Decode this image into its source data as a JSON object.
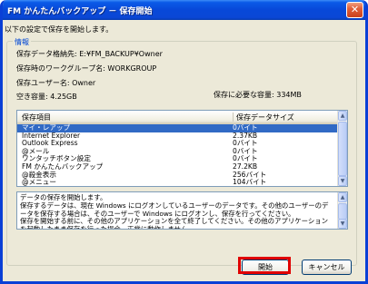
{
  "window": {
    "title": "FM かんたんバックアップ － 保存開始"
  },
  "intro_text": "以下の設定で保存を開始します。",
  "info": {
    "legend": "情報",
    "dest_label": "保存データ格納先: E:¥FM_BACKUP¥Owner",
    "workgroup_label": "保存時のワークグループ名: WORKGROUP",
    "user_label": "保存ユーザー名: Owner",
    "free_space": "空き容量:  4.25GB",
    "required_space": "保存に必要な容量:  334MB"
  },
  "list": {
    "headers": [
      "保存項目",
      "保存データサイズ"
    ],
    "rows": [
      {
        "name": "マイ・レアップ",
        "size": "0バイト",
        "selected": true
      },
      {
        "name": "Internet Explorer",
        "size": "2.37KB"
      },
      {
        "name": "Outlook Express",
        "size": "0バイト"
      },
      {
        "name": "@メール",
        "size": "0バイト"
      },
      {
        "name": "ワンタッチボタン設定",
        "size": "0バイト"
      },
      {
        "name": "FM かんたんバックアップ",
        "size": "27.2KB"
      },
      {
        "name": "@殺金表示",
        "size": "256バイト"
      },
      {
        "name": "@メニュー",
        "size": "104バイト"
      }
    ]
  },
  "description": "データの保存を開始します。\n保存するデータは、現在 Windows にログオンしているユーザーのデータです。その他のユーザーのデータを保存する場合は、そのユーザーで Windows にログオンし、保存を行ってください。\n保存を開始する前に、その他のアプリケーションを全て終了してください。その他のアプリケーションを起動したまま保存を行った場合、正常に動作しません。",
  "buttons": {
    "start": "開始",
    "cancel": "キャンセル"
  }
}
